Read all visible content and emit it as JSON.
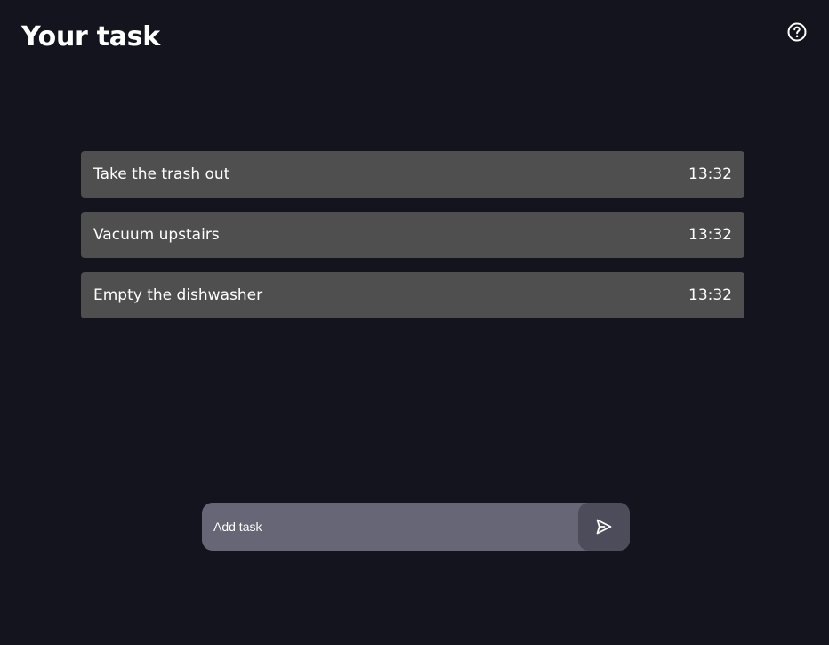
{
  "header": {
    "title": "Your task",
    "help_icon": "help-circle-icon"
  },
  "tasks": [
    {
      "text": "Take the trash out",
      "time": "13:32"
    },
    {
      "text": "Vacuum upstairs",
      "time": "13:32"
    },
    {
      "text": "Empty the dishwasher",
      "time": "13:32"
    }
  ],
  "composer": {
    "placeholder": "Add task",
    "value": "",
    "send_icon": "send-icon"
  },
  "colors": {
    "background": "#14141f",
    "task_background": "#4f4f4f",
    "input_background": "#666676",
    "send_button": "#4c4c5a",
    "text": "#ffffff"
  }
}
